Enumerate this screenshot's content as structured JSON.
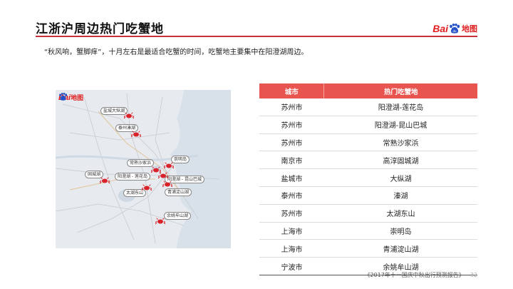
{
  "header": {
    "title": "江浙沪周边热门吃蟹地",
    "logo": {
      "bai": "Bai",
      "du": "du",
      "ditu": "地图"
    }
  },
  "subtitle": "“秋风响，蟹脚痒”，十月左右是最适合吃蟹的时间，吃蟹地主要集中在阳澄湖周边。",
  "map": {
    "logo": {
      "bai": "Bai",
      "du": "du",
      "ditu": "地图"
    },
    "labels": [
      "盐城大纵湖",
      "泰州溱湖",
      "常熟沙家浜",
      "崇明岛",
      "固城湖",
      "阳澄湖 - 莲花岛",
      "阳澄湖 - 昆山巴城",
      "太湖东山",
      "青浦淀山湖",
      "余姚牟山湖"
    ],
    "marker_icon": "crab-icon"
  },
  "table": {
    "headers": [
      "城市",
      "热门吃蟹地"
    ],
    "rows": [
      [
        "苏州市",
        "阳澄湖-莲花岛"
      ],
      [
        "苏州市",
        "阳澄湖-昆山巴城"
      ],
      [
        "苏州市",
        "常熟沙家浜"
      ],
      [
        "南京市",
        "高淳固城湖"
      ],
      [
        "盐城市",
        "大纵湖"
      ],
      [
        "泰州市",
        "溱湖"
      ],
      [
        "苏州市",
        "太湖东山"
      ],
      [
        "上海市",
        "崇明岛"
      ],
      [
        "上海市",
        "青浦淀山湖"
      ],
      [
        "宁波市",
        "余姚牟山湖"
      ]
    ],
    "header_color": "#e8554e"
  },
  "footer": {
    "source": "《2017年十一国庆中秋出行预测报告》",
    "page": "32"
  },
  "colors": {
    "accent": "#c9303a",
    "marker": "#d9232b"
  }
}
